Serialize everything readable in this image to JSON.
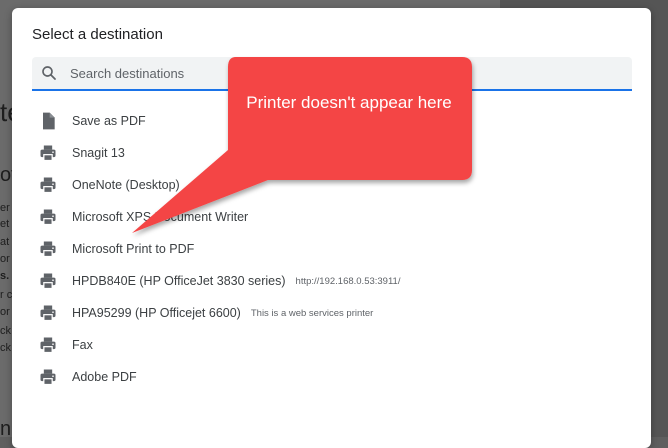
{
  "dialog": {
    "title": "Select a destination",
    "search_placeholder": "Search destinations"
  },
  "destinations": [
    {
      "label": "Save as PDF",
      "sub": "",
      "icon": "document-icon"
    },
    {
      "label": "Snagit 13",
      "sub": "",
      "icon": "printer-icon"
    },
    {
      "label": "OneNote (Desktop)",
      "sub": "",
      "icon": "printer-icon"
    },
    {
      "label": "Microsoft XPS Document Writer",
      "sub": "",
      "icon": "printer-icon"
    },
    {
      "label": "Microsoft Print to PDF",
      "sub": "",
      "icon": "printer-icon"
    },
    {
      "label": "HPDB840E (HP OfficeJet 3830 series)",
      "sub": "http://192.168.0.53:3911/",
      "icon": "printer-icon"
    },
    {
      "label": "HPA95299 (HP Officejet 6600)",
      "sub": "This is a web services printer",
      "icon": "printer-icon"
    },
    {
      "label": "Fax",
      "sub": "",
      "icon": "printer-icon"
    },
    {
      "label": "Adobe PDF",
      "sub": "",
      "icon": "printer-icon"
    }
  ],
  "annotation": {
    "text": "Printer doesn't appear here",
    "color": "#f44444"
  },
  "background_fragments": [
    "te",
    "ov",
    "er",
    "et",
    "at",
    "or",
    "s.",
    "r c",
    "or",
    "ck",
    "ck",
    "n’"
  ],
  "colors": {
    "accent": "#1a73e8",
    "icon": "#5f6368",
    "text": "#3c4043",
    "overlay": "#6b6b6b"
  }
}
